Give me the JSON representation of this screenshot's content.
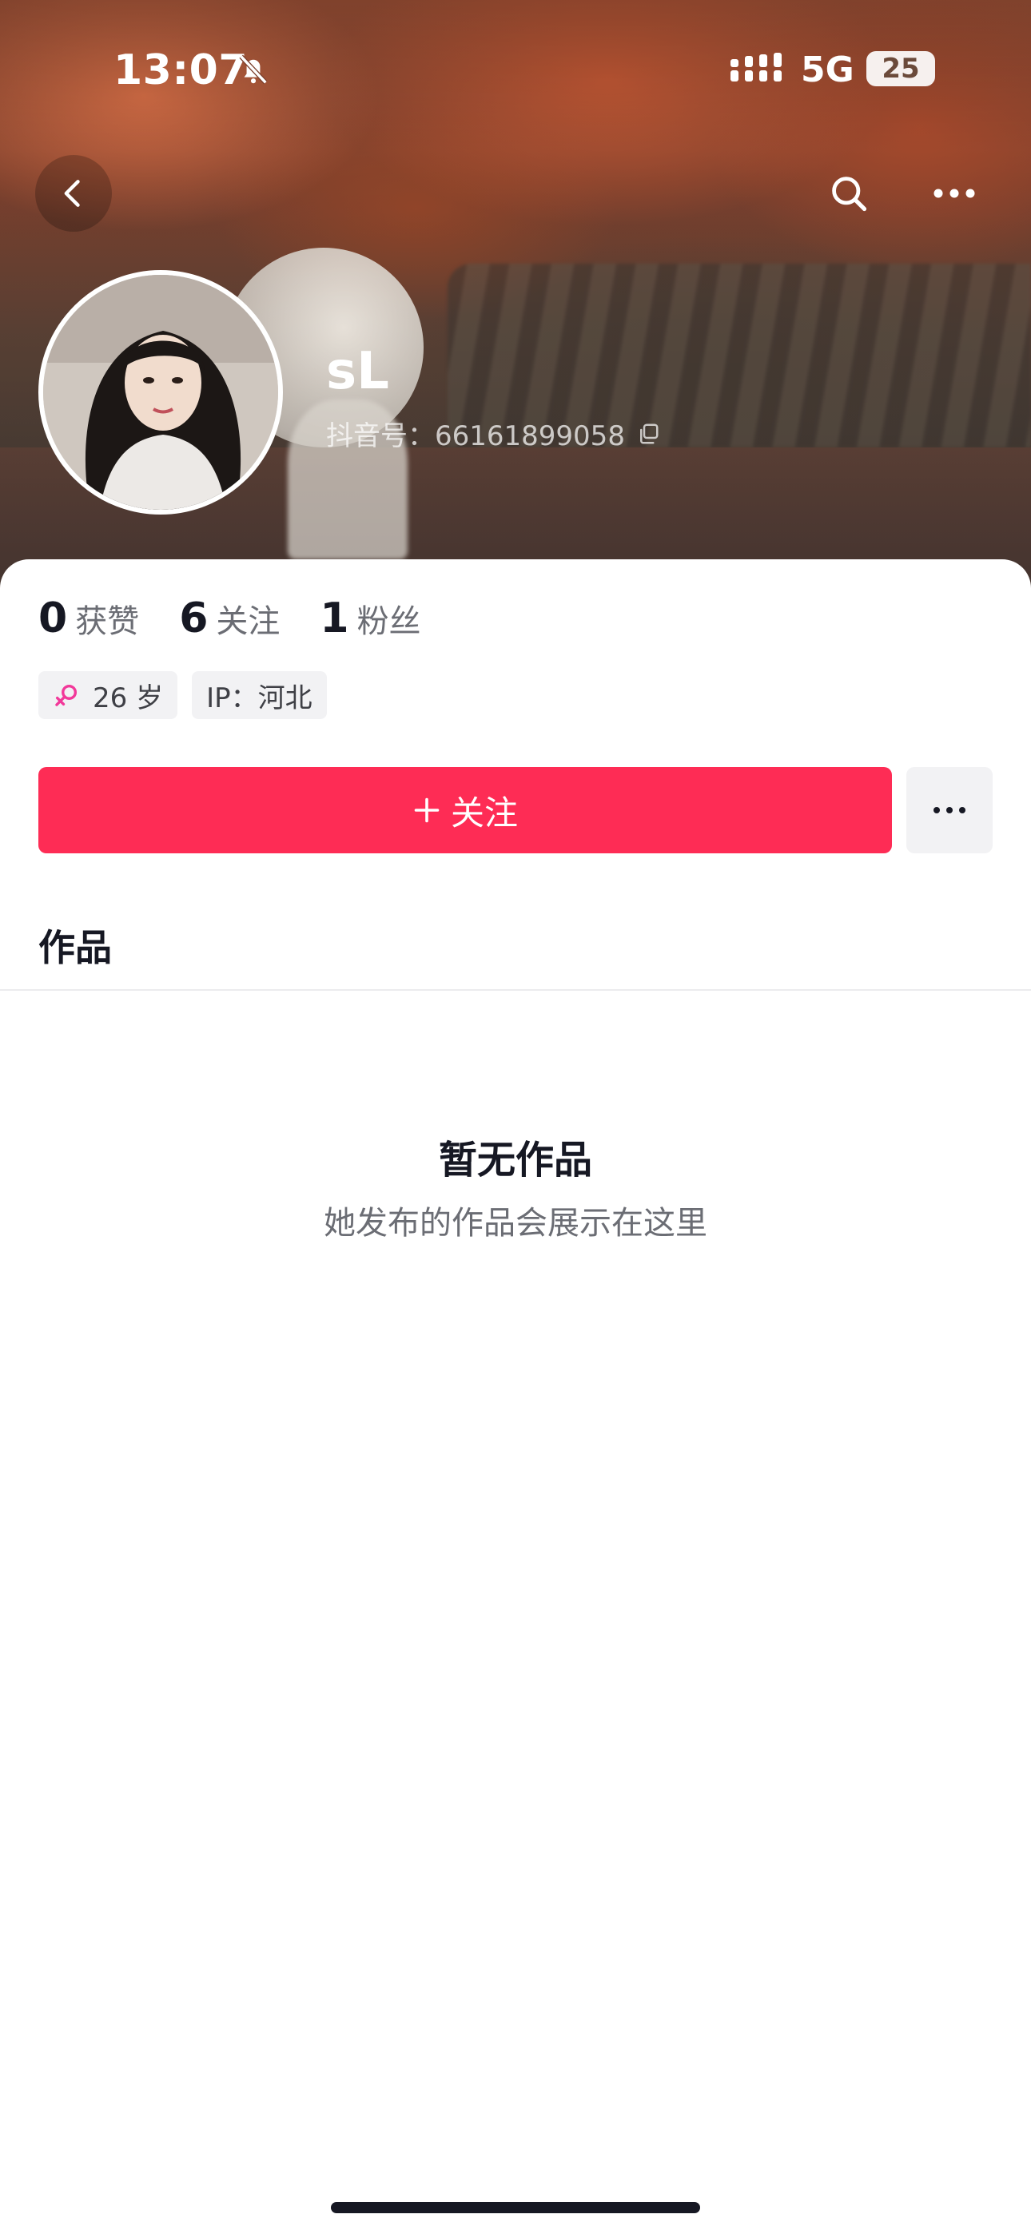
{
  "status_bar": {
    "time": "13:07",
    "network": "5G",
    "battery": "25"
  },
  "profile": {
    "name": "sL",
    "douyin_id": "抖音号：66161899058"
  },
  "stats": [
    {
      "value": "0",
      "label": "获赞"
    },
    {
      "value": "6",
      "label": "关注"
    },
    {
      "value": "1",
      "label": "粉丝"
    }
  ],
  "tags": {
    "age": "26 岁",
    "ip": "IP：河北"
  },
  "actions": {
    "follow_label": "关注"
  },
  "section": {
    "title": "作品"
  },
  "empty_state": {
    "title": "暂无作品",
    "subtitle": "她发布的作品会展示在这里"
  },
  "colors": {
    "accent": "#fe2c55",
    "text_primary": "#161823",
    "text_secondary": "#6b6d74",
    "tag_bg": "#f2f2f4",
    "female_pink": "#f2399a"
  },
  "icons": [
    "bell-off-icon",
    "signal-icon",
    "back-icon",
    "search-icon",
    "more-icon",
    "copy-icon",
    "female-icon",
    "plus-icon",
    "more-dots-icon"
  ]
}
